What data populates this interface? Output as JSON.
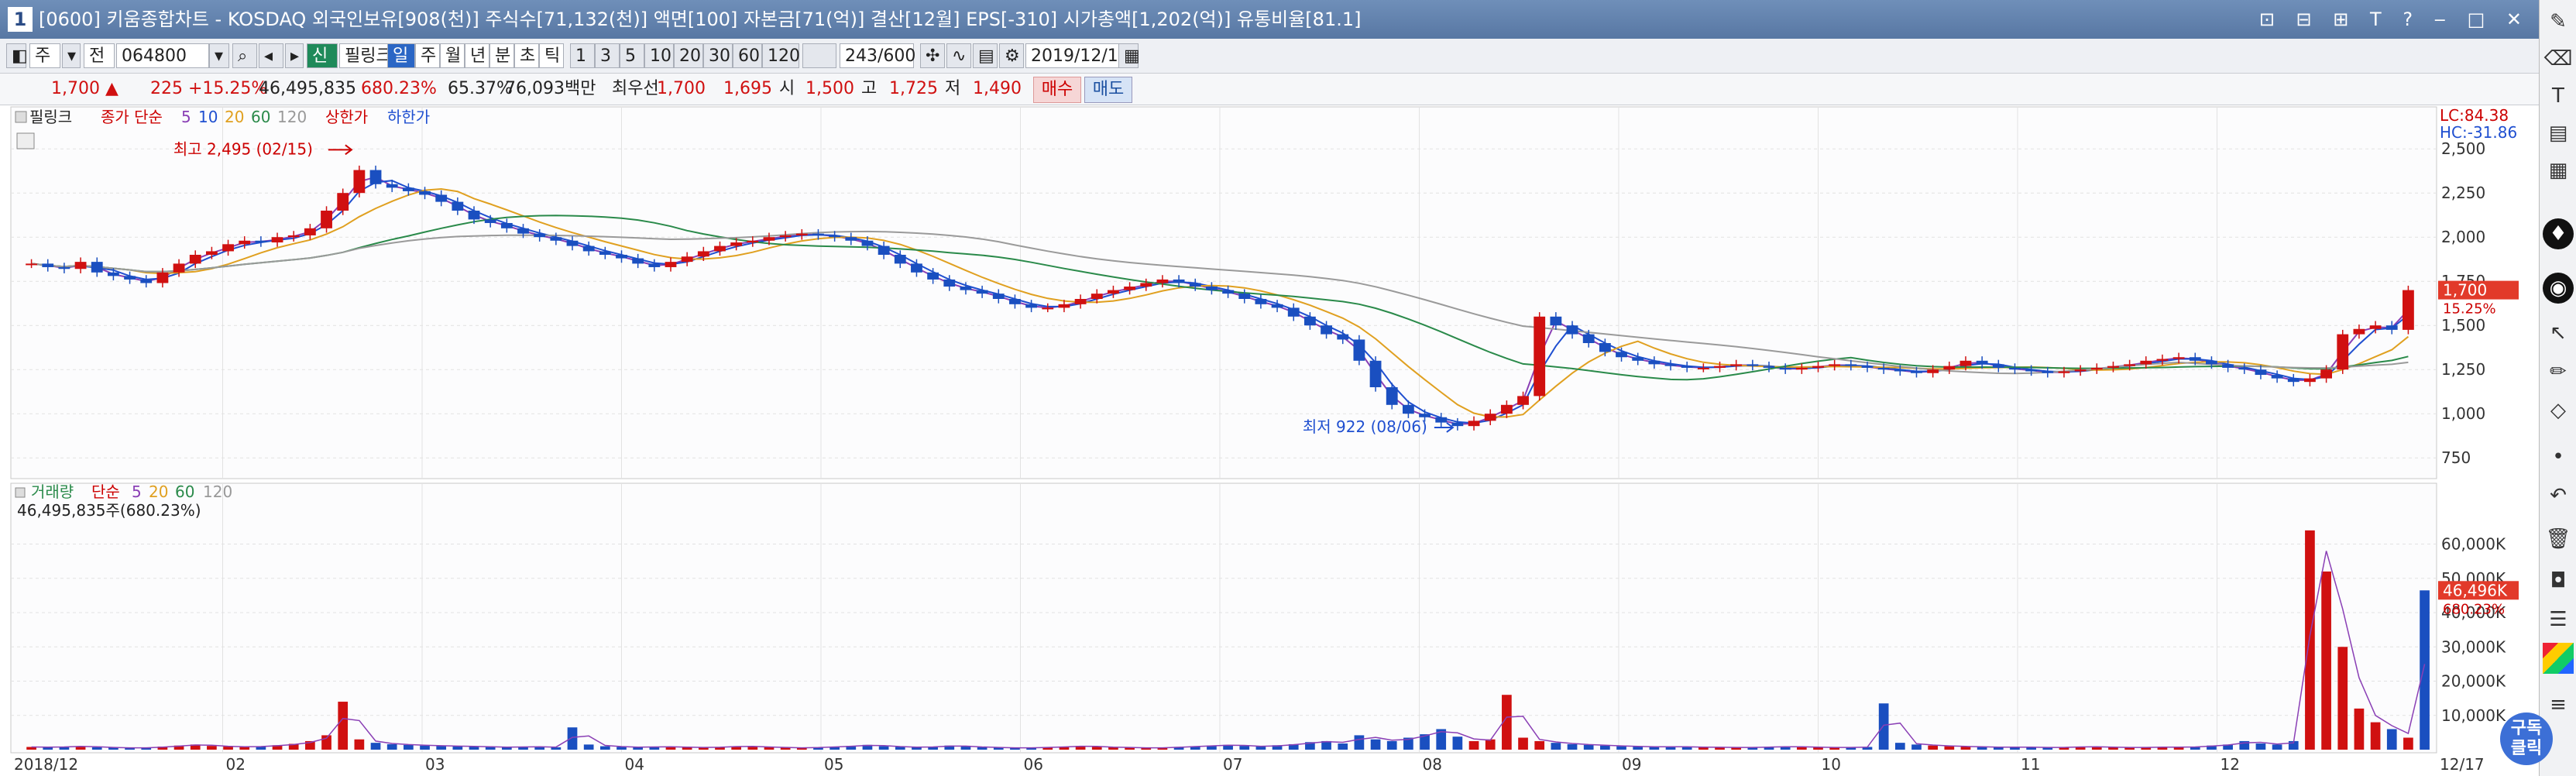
{
  "window": {
    "number": "1",
    "title": "[0600] 키움종합차트 - KOSDAQ 외국인보유[908(천)] 주식수[71,132(천)] 액면[100] 자본금[71(억)] 결산[12월] EPS[-310] 시가총액[1,202(억)] 유통비율[81.1]",
    "buttons": "⊡ ⊟ ⊞ T ? ‒ □ ✕"
  },
  "toolbar": {
    "period_btn": "주",
    "period_all": "전",
    "code": "064800",
    "sin": "신",
    "stock_name": "필링크",
    "tabs": [
      "일",
      "주",
      "월",
      "년",
      "분",
      "초",
      "틱"
    ],
    "intervals": [
      "1",
      "3",
      "5",
      "10",
      "20",
      "30",
      "60",
      "120"
    ],
    "count": "243/600",
    "date": "2019/12/17",
    "buy": "매수",
    "sell": "매도"
  },
  "info": {
    "price": "1,700 ▲",
    "change": "225 +15.25%",
    "volume": "46,495,835",
    "vol_ratio": "680.23%",
    "turnover": "65.37%",
    "amount": "76,093백만",
    "best": "최우선",
    "ask": "1,700",
    "bid": "1,695",
    "open_label": "시",
    "open": "1,500",
    "high_label": "고",
    "high": "1,725",
    "low_label": "저",
    "low": "1,490"
  },
  "price_legend": {
    "name": "필링크",
    "ma_prefix": "종가 단순",
    "ma_periods": [
      "5",
      "10",
      "20",
      "60",
      "120"
    ],
    "upper": "상한가",
    "lower": "하한가"
  },
  "volume_legend": {
    "name": "거래량",
    "ma_prefix": "단순",
    "ma_periods": [
      "5",
      "20",
      "60",
      "120"
    ],
    "value": "46,495,835주(680.23%)"
  },
  "corner": {
    "lc": "LC:84.38",
    "hc": "HC:-31.86",
    "date": "12/17"
  },
  "colors": {
    "up": "#d01010",
    "down": "#1a4fc0",
    "ma5": "#8a3fb5",
    "ma10": "#1f4fd0",
    "ma20": "#e0a020",
    "ma60": "#2a8a4a",
    "ma120": "#9a9a9a"
  },
  "chart_data": [
    {
      "type": "candlestick",
      "title": "필링크",
      "y_ticks": [
        "2,500",
        "2,250",
        "2,000",
        "1,750",
        "1,500",
        "1,250",
        "1,000",
        "750"
      ],
      "ylim": [
        650,
        2650
      ],
      "x_ticks": [
        "2018/12",
        "02",
        "03",
        "04",
        "05",
        "06",
        "07",
        "08",
        "09",
        "10",
        "11",
        "12"
      ],
      "current_price_tag": "1,700",
      "current_change_tag": "15.25%",
      "annotations": [
        {
          "text": "최고 2,495 (02/15)",
          "value": 2495
        },
        {
          "text": "최저 922 (08/06)",
          "value": 922
        }
      ],
      "close": [
        1850,
        1830,
        1820,
        1860,
        1800,
        1780,
        1760,
        1740,
        1800,
        1850,
        1900,
        1920,
        1960,
        1980,
        1970,
        2000,
        2010,
        2050,
        2150,
        2250,
        2380,
        2300,
        2280,
        2260,
        2240,
        2200,
        2150,
        2100,
        2080,
        2050,
        2020,
        2000,
        1980,
        1950,
        1920,
        1900,
        1880,
        1850,
        1830,
        1860,
        1890,
        1920,
        1950,
        1970,
        1980,
        2000,
        2010,
        2020,
        2010,
        2000,
        1980,
        1950,
        1900,
        1850,
        1800,
        1760,
        1720,
        1700,
        1680,
        1650,
        1620,
        1600,
        1600,
        1620,
        1650,
        1680,
        1700,
        1720,
        1740,
        1760,
        1740,
        1720,
        1700,
        1680,
        1650,
        1620,
        1600,
        1550,
        1500,
        1450,
        1420,
        1300,
        1150,
        1050,
        1000,
        980,
        950,
        930,
        960,
        1000,
        1050,
        1100,
        1550,
        1500,
        1450,
        1400,
        1350,
        1320,
        1300,
        1280,
        1270,
        1260,
        1260,
        1270,
        1280,
        1270,
        1260,
        1250,
        1260,
        1270,
        1280,
        1270,
        1260,
        1250,
        1240,
        1230,
        1250,
        1270,
        1300,
        1280,
        1260,
        1250,
        1240,
        1230,
        1240,
        1250,
        1260,
        1270,
        1280,
        1300,
        1310,
        1320,
        1300,
        1280,
        1260,
        1250,
        1220,
        1200,
        1180,
        1200,
        1250,
        1450,
        1480,
        1500,
        1475,
        1700
      ]
    },
    {
      "type": "bar",
      "title": "거래량",
      "y_ticks": [
        "60,000K",
        "50,000K",
        "40,000K",
        "30,000K",
        "20,000K",
        "10,000K"
      ],
      "ylim": [
        0,
        66000
      ],
      "current_tag": "46,496K",
      "current_pct_tag": "680.23%",
      "values": [
        800,
        700,
        900,
        1000,
        700,
        600,
        500,
        600,
        900,
        1200,
        1500,
        1100,
        900,
        800,
        1000,
        1300,
        1700,
        2500,
        4200,
        14000,
        3000,
        2000,
        1600,
        1400,
        1200,
        1100,
        1000,
        900,
        800,
        700,
        900,
        800,
        700,
        6500,
        1500,
        1000,
        800,
        700,
        900,
        800,
        700,
        600,
        800,
        1000,
        900,
        700,
        600,
        500,
        700,
        900,
        1100,
        1400,
        1000,
        800,
        700,
        900,
        1200,
        900,
        700,
        600,
        500,
        600,
        700,
        900,
        1100,
        800,
        700,
        600,
        500,
        600,
        800,
        1000,
        1200,
        1400,
        1100,
        900,
        1300,
        1600,
        2200,
        2500,
        1800,
        4200,
        3000,
        2500,
        3500,
        4500,
        6000,
        3800,
        2500,
        3000,
        16000,
        3500,
        2500,
        2000,
        1600,
        1400,
        1200,
        1000,
        900,
        800,
        900,
        800,
        700,
        700,
        600,
        700,
        800,
        900,
        800,
        700,
        600,
        700,
        800,
        13500,
        2000,
        1500,
        1200,
        1000,
        900,
        800,
        700,
        800,
        700,
        600,
        700,
        900,
        800,
        700,
        600,
        700,
        800,
        700,
        900,
        1200,
        1500,
        2500,
        1800,
        1500,
        2500,
        64000,
        52000,
        30000,
        12000,
        8000,
        6000,
        3500,
        46496
      ]
    }
  ]
}
